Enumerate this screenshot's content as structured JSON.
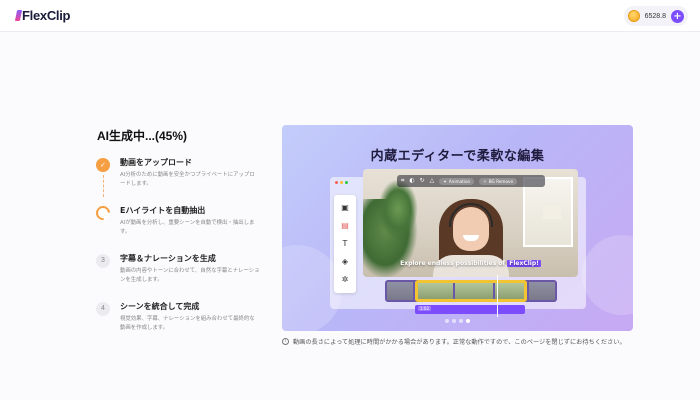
{
  "header": {
    "logo_text": "lexClip",
    "credits": "6528.8",
    "add_label": "+"
  },
  "progress": {
    "title": "AI生成中...(45%)",
    "value_percent": 45
  },
  "steps": [
    {
      "title": "動画をアップロード",
      "desc": "AI分析のために動画を安全かつプライベートにアップロードします。",
      "status": "done",
      "number": ""
    },
    {
      "title": "Eハイライトを自動抽出",
      "desc": "AIが動画を分析し、重要シーンを自動で検出・抽出します。",
      "status": "active",
      "number": ""
    },
    {
      "title": "字幕＆ナレーションを生成",
      "desc": "動画の内容やトーンに合わせて、自然な字幕とナレーションを生成します。",
      "status": "pending",
      "number": "3"
    },
    {
      "title": "シーンを統合して完成",
      "desc": "視覚効果、字幕、ナレーションを組み合わせて最終的な動画を作成します。",
      "status": "pending",
      "number": "4"
    }
  ],
  "banner": {
    "title": "内蔵エディターで柔軟な編集",
    "toolbar_pill_1": "Animation",
    "toolbar_pill_2": "BG Remove",
    "caption_prefix": "Explore endless possibilities of",
    "caption_brand": "FlexClip!",
    "subtitle_chip": "1:02",
    "pager_count": 4,
    "pager_active": 3
  },
  "notice": {
    "icon": "info-icon",
    "text": "動画の長さによって処理に時間がかかる場合があります。正常な動作ですので、このページを閉じずにお待ちください。"
  },
  "colors": {
    "accent": "#7c4dff",
    "step_done": "#f59e42"
  }
}
